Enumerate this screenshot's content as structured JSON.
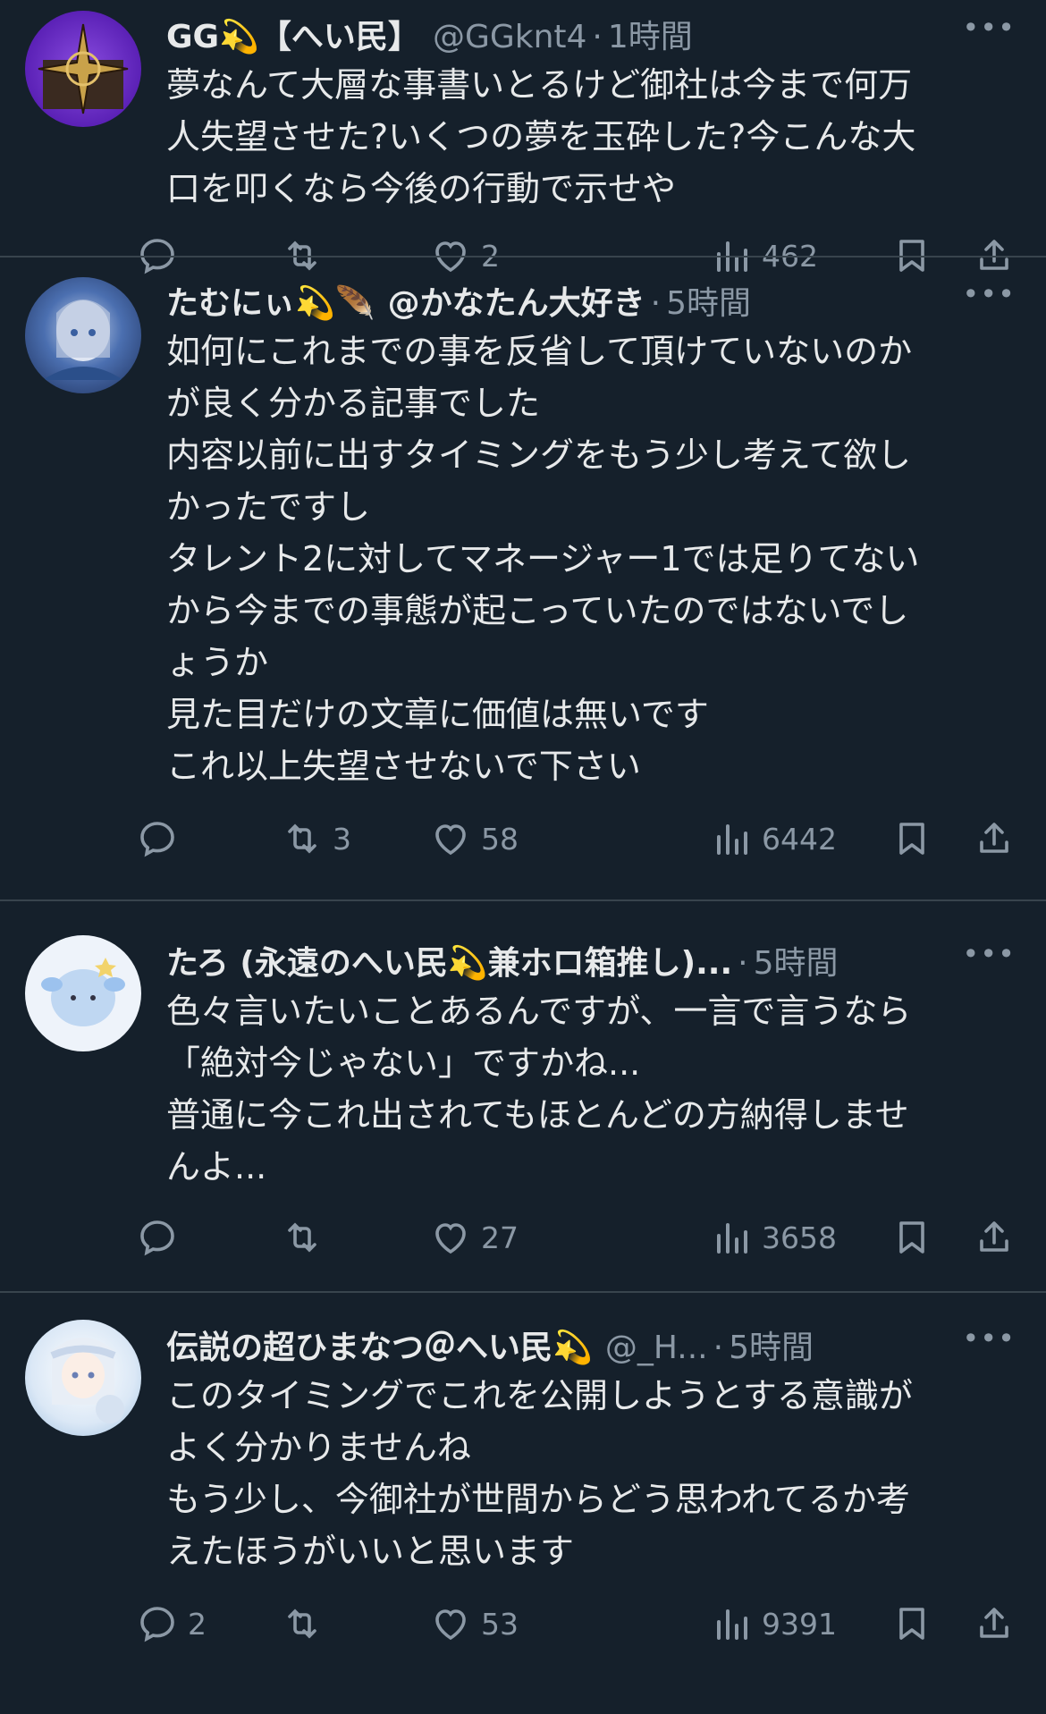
{
  "tweets": [
    {
      "name": "GG💫【へい民】",
      "handle": "@GGknt4",
      "dot": "·",
      "time": "1時間",
      "more": "•••",
      "text": "夢なんて大層な事書いとるけど御社は今まで何万\n人失望させた?いくつの夢を玉砕した?今こんな大\n口を叩くなら今後の行動で示せや",
      "replies": "",
      "retweets": "",
      "likes": "2",
      "views": "462",
      "avatar_color": "#6b2fbf"
    },
    {
      "name": "たむにぃ💫🪶",
      "handle": "@かなたん大好き",
      "dot": "·",
      "time": "5時間",
      "more": "•••",
      "text": "如何にこれまでの事を反省して頂けていないのか\nが良く分かる記事でした\n内容以前に出すタイミングをもう少し考えて欲し\nかったですし\nタレント2に対してマネージャー1では足りてない\nから今までの事態が起こっていたのではないでし\nょうか\n見た目だけの文章に価値は無いです\nこれ以上失望させないで下さい",
      "replies": "",
      "retweets": "3",
      "likes": "58",
      "views": "6442",
      "avatar_color": "#2b4f8a"
    },
    {
      "name": "たろ (永遠のへい民💫兼ホロ箱推し)...",
      "handle": "",
      "dot": "·",
      "time": "5時間",
      "more": "•••",
      "text": "色々言いたいことあるんですが、一言で言うなら\n「絶対今じゃない」ですかね...\n普通に今これ出されてもほとんどの方納得しませ\nんよ...",
      "replies": "",
      "retweets": "",
      "likes": "27",
      "views": "3658",
      "avatar_color": "#f3f6fb"
    },
    {
      "name": "伝説の超ひまなつ＠へい民💫",
      "handle": "@_H...",
      "dot": "·",
      "time": "5時間",
      "more": "•••",
      "text": "このタイミングでこれを公開しようとする意識が\nよく分かりませんね\nもう少し、今御社が世間からどう思われてるか考\nえたほうがいいと思います",
      "replies": "2",
      "retweets": "",
      "likes": "53",
      "views": "9391",
      "avatar_color": "#cfe3f5"
    }
  ]
}
